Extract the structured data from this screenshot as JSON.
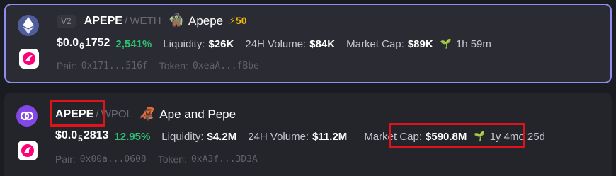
{
  "pairs": [
    {
      "version": "V2",
      "base_symbol": "APEPE",
      "separator": "/",
      "quote_symbol": "WETH",
      "emoji": "🧌",
      "name": "Apepe",
      "boost_icon": "⚡",
      "boost_count": "50",
      "price_prefix": "$0.0",
      "price_zeros": "6",
      "price_digits": "1752",
      "change": "2,541%",
      "liquidity_label": "Liquidity:",
      "liquidity": "$26K",
      "volume_label": "24H Volume:",
      "volume": "$84K",
      "mcap_label": "Market Cap:",
      "mcap": "$89K",
      "age": "1h 59m",
      "pair_label": "Pair:",
      "pair_address": "0x171...516f",
      "token_label": "Token:",
      "token_address": "0xeaA...fBbe",
      "chain_icon": "ethereum-icon",
      "dex_icon": "uniswap-icon",
      "selected": true
    },
    {
      "base_symbol": "APEPE",
      "separator": "/",
      "quote_symbol": "WPOL",
      "emoji": "🦧",
      "name": "Ape and Pepe",
      "price_prefix": "$0.0",
      "price_zeros": "5",
      "price_digits": "2813",
      "change": "12.95%",
      "liquidity_label": "Liquidity:",
      "liquidity": "$4.2M",
      "volume_label": "24H Volume:",
      "volume": "$11.2M",
      "mcap_label": "Market Cap:",
      "mcap": "$590.8M",
      "age": "1y 4mo 25d",
      "pair_label": "Pair:",
      "pair_address": "0x00a...0608",
      "token_label": "Token:",
      "token_address": "0xA3f...3D3A",
      "chain_icon": "polygon-icon",
      "dex_icon": "uniswap-icon",
      "selected": false
    }
  ],
  "colors": {
    "accent_border": "#8e8df0",
    "positive": "#2fbf71",
    "boost": "#f0b90b",
    "highlight": "#e0121b",
    "uniswap_pink": "#ff007a",
    "polygon_purple": "#8247e5",
    "ethereum_bg": "#627eea"
  }
}
